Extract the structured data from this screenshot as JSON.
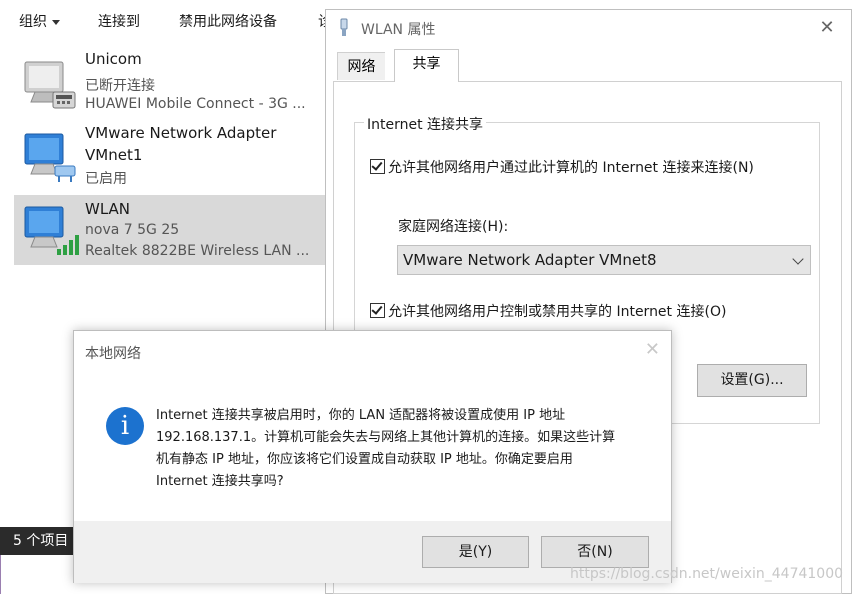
{
  "explorer": {
    "toolbar": [
      "组织",
      "连接到",
      "禁用此网络设备",
      "诊"
    ],
    "connections": [
      {
        "name": "Unicom",
        "status": "已断开连接",
        "device": "HUAWEI Mobile Connect - 3G ..."
      },
      {
        "name": "VMware Network Adapter",
        "name2": "VMnet1",
        "status": "已启用"
      },
      {
        "name": "WLAN",
        "status": "nova 7 5G 25",
        "device": "Realtek 8822BE Wireless LAN ..."
      }
    ],
    "status_count": "5 个项目"
  },
  "props": {
    "title": "WLAN 属性",
    "close": "✕",
    "tabs": [
      "网络",
      "共享"
    ],
    "group_title": "Internet 连接共享",
    "allow_share": "允许其他网络用户通过此计算机的 Internet 连接来连接(N)",
    "home_label": "家庭网络连接(H):",
    "home_value": "VMware Network Adapter VMnet8",
    "allow_control": "允许其他网络用户控制或禁用共享的 Internet 连接(O)",
    "settings_button": "设置(G)..."
  },
  "dialog": {
    "title": "本地网络",
    "close": "✕",
    "icon": "i",
    "lines": [
      "Internet 连接共享被启用时，你的 LAN 适配器将被设置成使用 IP 地址",
      "192.168.137.1。计算机可能会失去与网络上其他计算机的连接。如果这些计算",
      "机有静态 IP 地址，你应该将它们设置成自动获取 IP 地址。你确定要启用",
      "Internet 连接共享吗?"
    ],
    "yes": "是(Y)",
    "no": "否(N)"
  },
  "watermark": "https://blog.csdn.net/weixin_44741000"
}
